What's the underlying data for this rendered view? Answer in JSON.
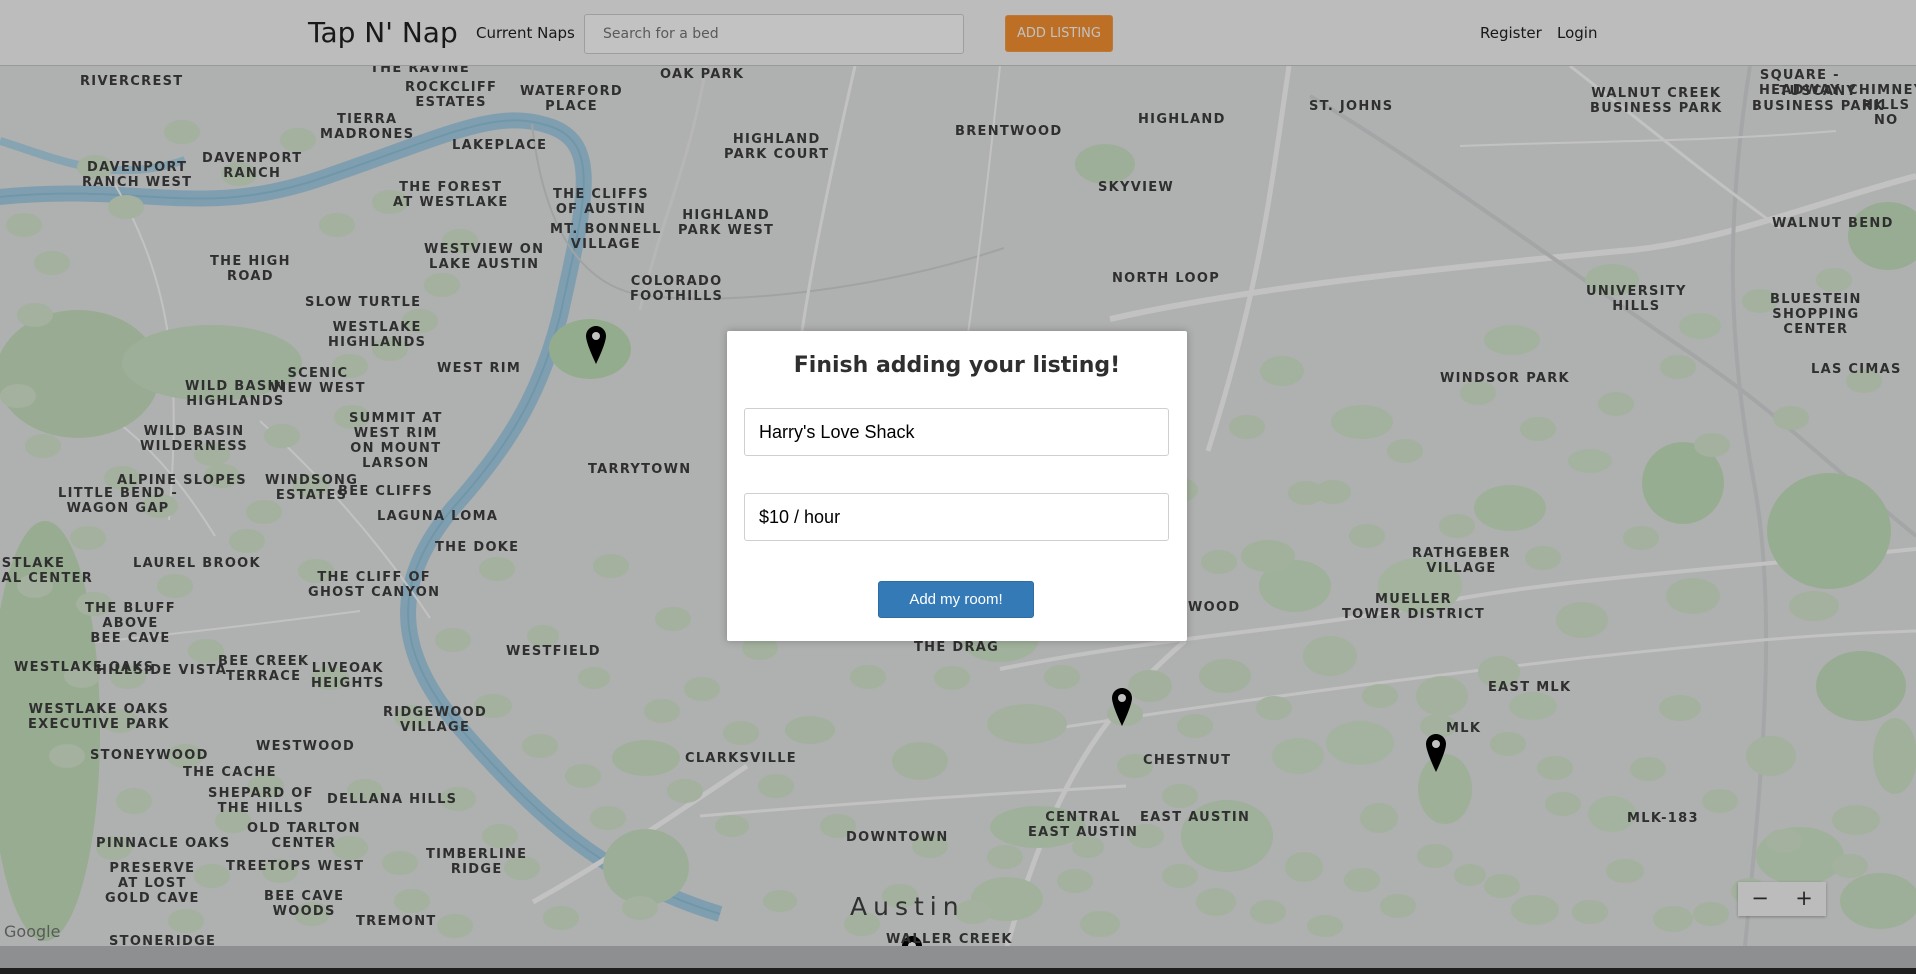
{
  "header": {
    "brand": "Tap N' Nap",
    "nav_current_naps": "Current Naps",
    "search_placeholder": "Search for a bed",
    "add_listing_label": "ADD LISTING",
    "register_label": "Register",
    "login_label": "Login"
  },
  "map": {
    "city_label": "Austin",
    "labels": [
      {
        "text": "RIVERCREST"
      },
      {
        "text": "THE RAVINE"
      },
      {
        "text": "ROCKCLIFF\nESTATES"
      },
      {
        "text": "WATERFORD\nPLACE"
      },
      {
        "text": "OAK PARK"
      },
      {
        "text": "HIGHLAND\nPARK COURT"
      },
      {
        "text": "BRENTWOOD"
      },
      {
        "text": "HIGHLAND"
      },
      {
        "text": "ST. JOHNS"
      },
      {
        "text": "WALNUT CREEK\nBUSINESS PARK"
      },
      {
        "text": "TUSCANY\nBUSINESS PARK"
      },
      {
        "text": "DAVENPORT\nRANCH WEST"
      },
      {
        "text": "DAVENPORT\nRANCH"
      },
      {
        "text": "TIERRA\nMADRONES"
      },
      {
        "text": "LAKEPLACE"
      },
      {
        "text": "THE FOREST\nAT WESTLAKE"
      },
      {
        "text": "THE CLIFFS\nOF AUSTIN"
      },
      {
        "text": "MT. BONNELL\nVILLAGE"
      },
      {
        "text": "HIGHLAND\nPARK WEST"
      },
      {
        "text": "SKYVIEW"
      },
      {
        "text": "WALNUT BEND"
      },
      {
        "text": "THE HIGH\nROAD"
      },
      {
        "text": "WESTVIEW ON\nLAKE AUSTIN"
      },
      {
        "text": "COLORADO\nFOOTHILLS"
      },
      {
        "text": "NORTH LOOP"
      },
      {
        "text": "UNIVERSITY\nHILLS"
      },
      {
        "text": "BLUESTEIN\nSHOPPING\nCENTER"
      },
      {
        "text": "SLOW TURTLE"
      },
      {
        "text": "WESTLAKE\nHIGHLANDS"
      },
      {
        "text": "LAS CIMAS"
      },
      {
        "text": "WEST RIM"
      },
      {
        "text": "WINDSOR PARK"
      },
      {
        "text": "WILD BASIN\nHIGHLANDS"
      },
      {
        "text": "SCENIC\nVIEW WEST"
      },
      {
        "text": "SUMMIT AT\nWEST RIM\nON MOUNT\nLARSON"
      },
      {
        "text": "WILD BASIN\nWILDERNESS"
      },
      {
        "text": "TARRYTOWN"
      },
      {
        "text": "ALPINE SLOPES"
      },
      {
        "text": "WINDSONG\nESTATES"
      },
      {
        "text": "LITTLE BEND -\nWAGON GAP"
      },
      {
        "text": "BEE CLIFFS"
      },
      {
        "text": "LAGUNA LOMA"
      },
      {
        "text": "RATHGEBER\nVILLAGE"
      },
      {
        "text": "WESTLAKE\nMEDICAL CENTER"
      },
      {
        "text": "LAUREL BROOK"
      },
      {
        "text": "THE DOKE"
      },
      {
        "text": "MUELLER\nTOWER DISTRICT"
      },
      {
        "text": "THE CLIFF OF\nGHOST CANYON"
      },
      {
        "text": "THE BLUFF\nABOVE\nBEE CAVE"
      },
      {
        "text": "WESTFIELD"
      },
      {
        "text": "WOOD"
      },
      {
        "text": "THE DRAG"
      },
      {
        "text": "WESTLAKE OAKS"
      },
      {
        "text": "BEE CREEK\nTERRACE"
      },
      {
        "text": "LIVEOAK\nHEIGHTS"
      },
      {
        "text": "EAST MLK"
      },
      {
        "text": "HILLSIDE VISTA"
      },
      {
        "text": "WESTLAKE OAKS\nEXECUTIVE PARK"
      },
      {
        "text": "RIDGEWOOD\nVILLAGE"
      },
      {
        "text": "MLK"
      },
      {
        "text": "WESTWOOD"
      },
      {
        "text": "STONEYWOOD"
      },
      {
        "text": "CLARKSVILLE"
      },
      {
        "text": "CHESTNUT"
      },
      {
        "text": "THE CACHE"
      },
      {
        "text": "SHEPARD OF\nTHE HILLS"
      },
      {
        "text": "DELLANA HILLS"
      },
      {
        "text": "CENTRAL\nEAST AUSTIN"
      },
      {
        "text": "EAST AUSTIN"
      },
      {
        "text": "MLK-183"
      },
      {
        "text": "PINNACLE OAKS"
      },
      {
        "text": "OLD TARLTON\nCENTER"
      },
      {
        "text": "PRESERVE\nAT LOST\nGOLD CAVE"
      },
      {
        "text": "TREETOPS WEST"
      },
      {
        "text": "TIMBERLINE\nRIDGE"
      },
      {
        "text": "DOWNTOWN"
      },
      {
        "text": "BEE CAVE\nWOODS"
      },
      {
        "text": "TREMONT"
      },
      {
        "text": "STONERIDGE"
      },
      {
        "text": "WALLER CREEK"
      },
      {
        "text": "SQUARE -\nHEADWAY"
      },
      {
        "text": "CHIMNEY\nHILLS NO"
      }
    ],
    "zoom_minus": "−",
    "zoom_plus": "+",
    "google_label": "Google"
  },
  "modal": {
    "title": "Finish adding your listing!",
    "name_value": "Harry's Love Shack",
    "price_value": "$10 / hour",
    "submit_label": "Add my room!"
  }
}
